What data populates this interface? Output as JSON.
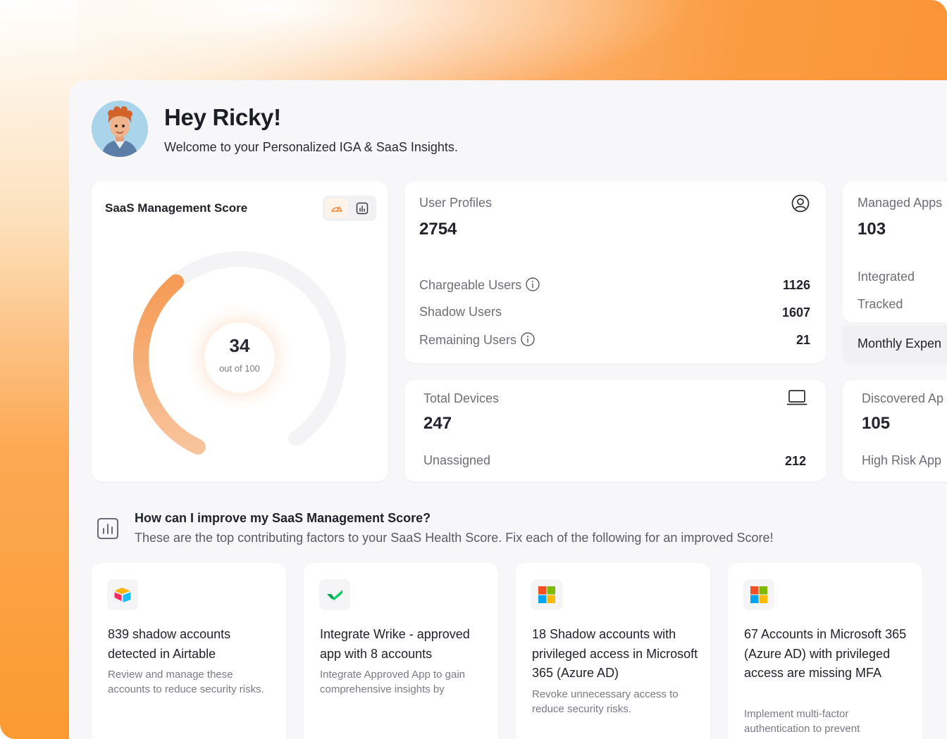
{
  "header": {
    "greeting": "Hey Ricky!",
    "subtitle": "Welcome to your Personalized IGA & SaaS Insights."
  },
  "score_card": {
    "title": "SaaS Management Score",
    "score": "34",
    "score_caption": "out of 100",
    "score_fraction": 0.34,
    "accent_color": "#f6a15f",
    "toggle_icons": [
      "gauge-icon",
      "bar-chart-icon"
    ]
  },
  "user_profiles": {
    "title": "User Profiles",
    "total": "2754",
    "icon": "user-circle-icon",
    "rows": [
      {
        "label": "Chargeable Users",
        "value": "1126",
        "info": true
      },
      {
        "label": "Shadow Users",
        "value": "1607",
        "info": false
      },
      {
        "label": "Remaining Users",
        "value": "21",
        "info": true
      }
    ]
  },
  "managed_apps": {
    "title": "Managed Apps",
    "total": "103",
    "rows": [
      {
        "label": "Integrated"
      },
      {
        "label": "Tracked"
      }
    ],
    "footer": "Monthly Expen"
  },
  "total_devices": {
    "title": "Total Devices",
    "total": "247",
    "icon": "laptop-icon",
    "rows": [
      {
        "label": "Unassigned",
        "value": "212"
      }
    ]
  },
  "discovered_apps": {
    "title": "Discovered Ap",
    "total": "105",
    "rows": [
      {
        "label": "High Risk App"
      }
    ]
  },
  "improve": {
    "title": "How can I improve my SaaS Management Score?",
    "subtitle": "These are the top contributing factors to your SaaS Health Score. Fix each of the following for an improved Score!",
    "cards": [
      {
        "logo": "airtable-logo-icon",
        "title": "839 shadow accounts detected in Airtable",
        "description": "Review and manage these accounts to reduce security risks."
      },
      {
        "logo": "wrike-logo-icon",
        "title": "Integrate Wrike - approved app with 8 accounts",
        "description": "Integrate Approved App to gain comprehensive insights by"
      },
      {
        "logo": "microsoft-logo-icon",
        "title": "18 Shadow accounts with privileged access in Microsoft 365 (Azure AD)",
        "description": "Revoke unnecessary access to reduce security risks."
      },
      {
        "logo": "microsoft-logo-icon",
        "title": "67 Accounts in Microsoft 365 (Azure AD) with privileged access are missing MFA",
        "description": "Implement multi-factor authentication to prevent"
      }
    ]
  }
}
